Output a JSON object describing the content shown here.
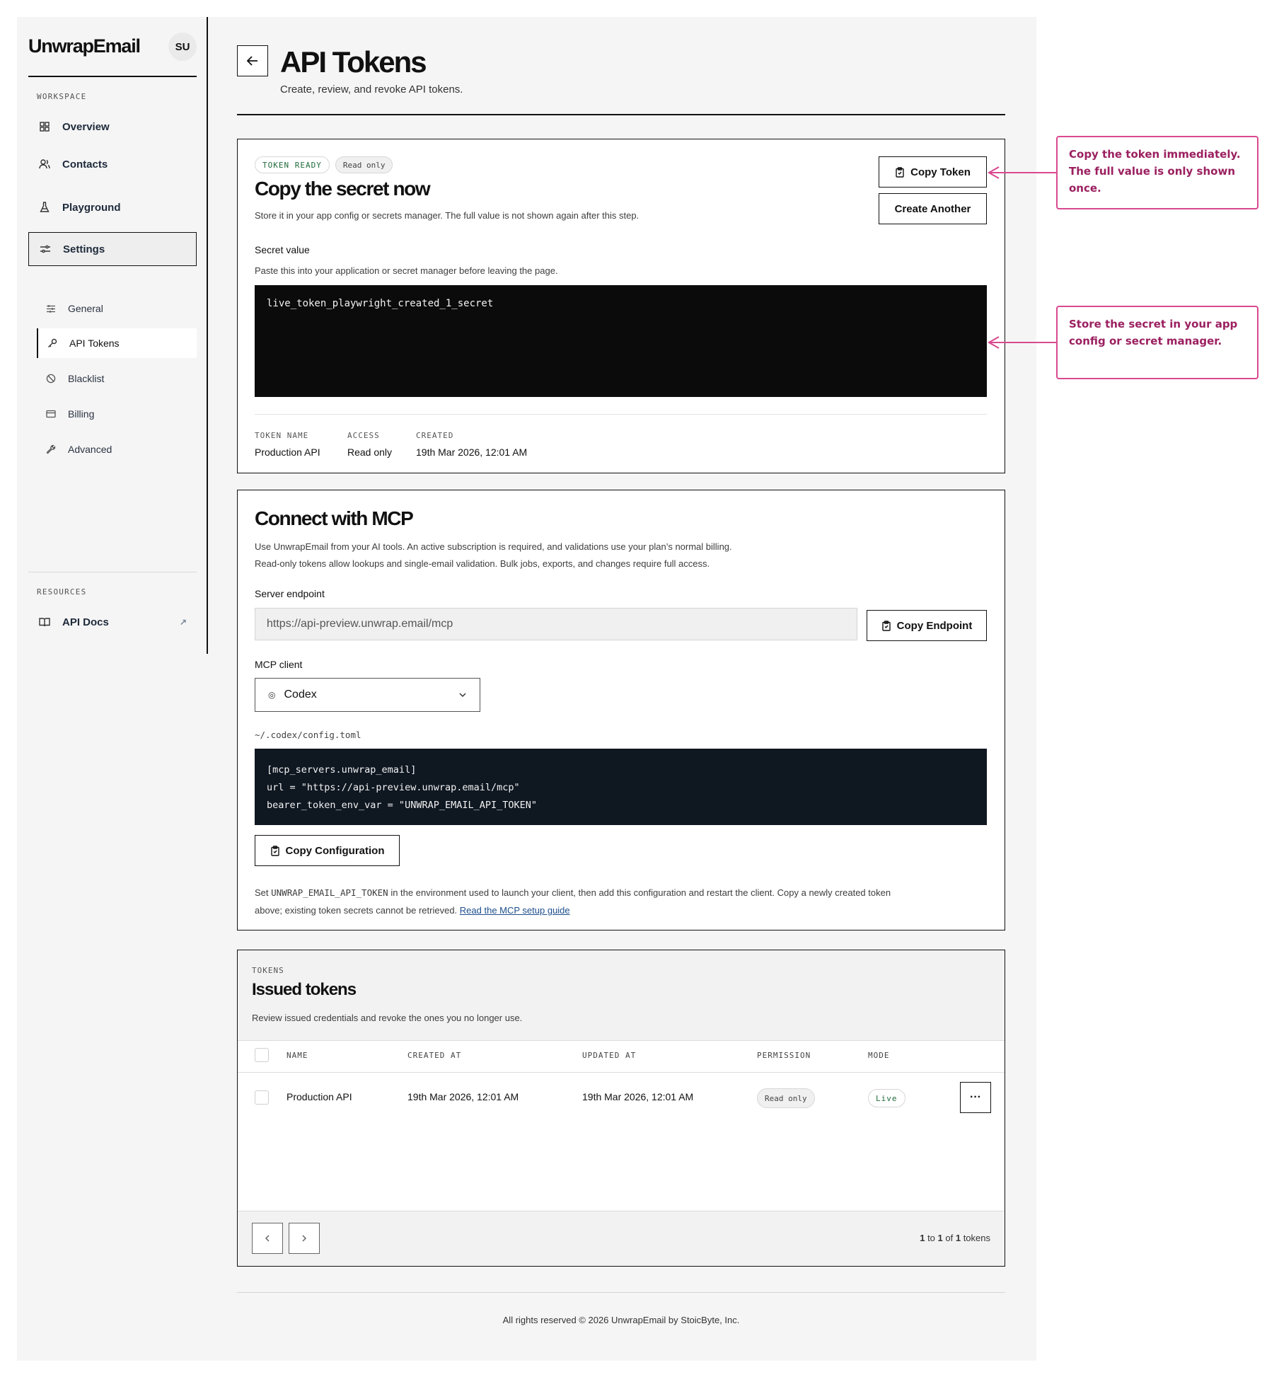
{
  "sidebar": {
    "brand": "UnwrapEmail",
    "avatar": "SU",
    "workspace_label": "WORKSPACE",
    "items": [
      {
        "label": "Overview",
        "icon": "grid-icon"
      },
      {
        "label": "Contacts",
        "icon": "users-icon"
      },
      {
        "label": "Playground",
        "icon": "flask-icon"
      },
      {
        "label": "Settings",
        "icon": "sliders-icon"
      }
    ],
    "settings_items": [
      {
        "label": "General",
        "icon": "sliders-icon"
      },
      {
        "label": "API Tokens",
        "icon": "key-icon"
      },
      {
        "label": "Blacklist",
        "icon": "ban-icon"
      },
      {
        "label": "Billing",
        "icon": "card-icon"
      },
      {
        "label": "Advanced",
        "icon": "wrench-icon"
      }
    ],
    "resources_label": "RESOURCES",
    "api_docs": "API Docs"
  },
  "header": {
    "title": "API Tokens",
    "subtitle": "Create, review, and revoke API tokens."
  },
  "secret_card": {
    "badge_status": "TOKEN READY",
    "badge_access": "Read only",
    "title": "Copy the secret now",
    "description": "Store it in your app config or secrets manager. The full value is not shown again after this step.",
    "copy_button": "Copy Token",
    "create_button": "Create Another",
    "secret_label": "Secret value",
    "secret_help": "Paste this into your application or secret manager before leaving the page.",
    "secret_value": "live_token_playwright_created_1_secret",
    "meta": {
      "name_label": "TOKEN NAME",
      "name_value": "Production API",
      "access_label": "ACCESS",
      "access_value": "Read only",
      "created_label": "CREATED",
      "created_value": "19th Mar 2026, 12:01 AM"
    }
  },
  "mcp_card": {
    "title": "Connect with MCP",
    "description_1": "Use UnwrapEmail from your AI tools. An active subscription is required, and validations use your plan’s normal billing.",
    "description_2": "Read-only tokens allow lookups and single-email validation. Bulk jobs, exports, and changes require full access.",
    "endpoint_label": "Server endpoint",
    "endpoint_value": "https://api-preview.unwrap.email/mcp",
    "copy_endpoint": "Copy Endpoint",
    "client_label": "MCP client",
    "client_value": "Codex",
    "config_path": "~/.codex/config.toml",
    "config_lines": [
      "[mcp_servers.unwrap_email]",
      "url = \"https://api-preview.unwrap.email/mcp\"",
      "bearer_token_env_var = \"UNWRAP_EMAIL_API_TOKEN\""
    ],
    "copy_config": "Copy Configuration",
    "note_prefix": "Set ",
    "note_env": "UNWRAP_EMAIL_API_TOKEN",
    "note_middle": " in the environment used to launch your client, then add this configuration and restart the client. Copy a newly created token",
    "note_line2": "above; existing token secrets cannot be retrieved. ",
    "note_link": "Read the MCP setup guide"
  },
  "tokens_table": {
    "eyebrow": "TOKENS",
    "title": "Issued tokens",
    "description": "Review issued credentials and revoke the ones you no longer use.",
    "columns": [
      "NAME",
      "CREATED AT",
      "UPDATED AT",
      "PERMISSION",
      "MODE"
    ],
    "rows": [
      {
        "name": "Production API",
        "created": "19th Mar 2026, 12:01 AM",
        "updated": "19th Mar 2026, 12:01 AM",
        "permission": "Read only",
        "mode": "Live"
      }
    ],
    "more": "···",
    "pagination": {
      "from": "1",
      "to_word": " to ",
      "to": "1",
      "of_word": " of ",
      "total": "1",
      "suffix": " tokens"
    }
  },
  "footer": "All rights reserved © 2026 UnwrapEmail by StoicByte, Inc.",
  "callouts": [
    "Copy the token immediately. The full value is only shown once.",
    "Store the secret in your app config or secret manager."
  ],
  "colors": {
    "accent_pink": "#d9498f",
    "callout_text": "#9b2060",
    "status_green": "#1f6b3b",
    "link": "#1d4e8c"
  }
}
